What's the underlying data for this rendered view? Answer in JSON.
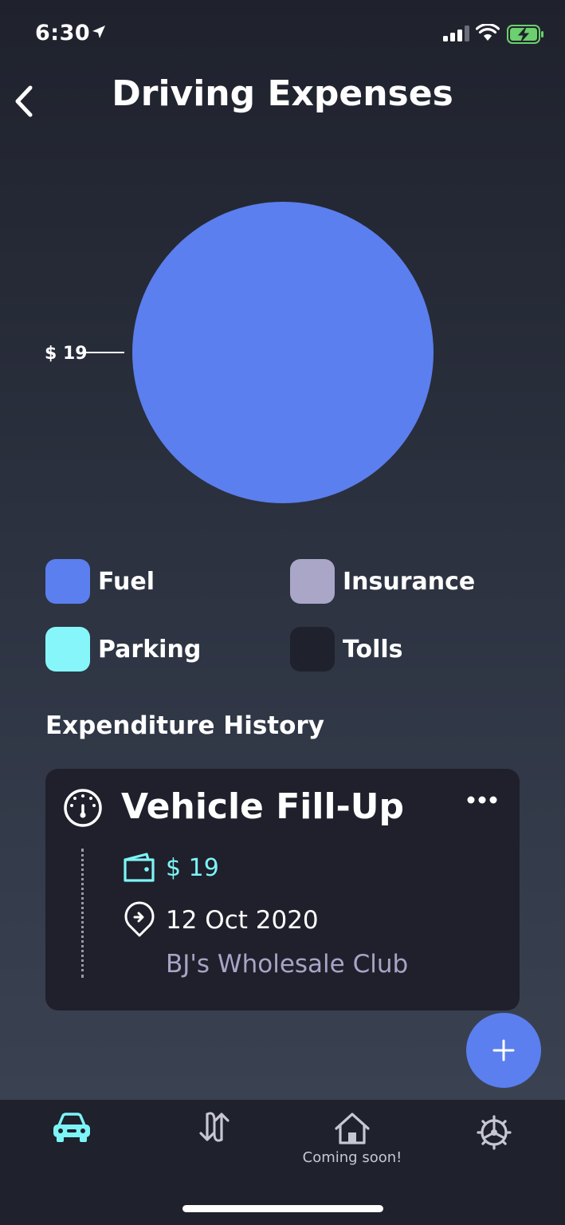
{
  "status_bar": {
    "time": "6:30"
  },
  "header": {
    "title": "Driving Expenses"
  },
  "chart_data": {
    "type": "pie",
    "slices": [
      {
        "label": "Fuel",
        "value": 19,
        "color": "#5b7fee"
      }
    ],
    "data_labels": [
      "$ 19"
    ],
    "legend": [
      {
        "label": "Fuel",
        "color": "#5b7fee"
      },
      {
        "label": "Insurance",
        "color": "#aaa6c8"
      },
      {
        "label": "Parking",
        "color": "#87f6fa"
      },
      {
        "label": "Tolls",
        "color": "#1f212c"
      }
    ],
    "legend_placement": "bottom"
  },
  "legend": {
    "fuel": "Fuel",
    "insurance": "Insurance",
    "parking": "Parking",
    "tolls": "Tolls"
  },
  "history": {
    "section_title": "Expenditure History",
    "items": [
      {
        "title": "Vehicle Fill-Up",
        "amount": "$ 19",
        "date": "12 Oct 2020",
        "place": "BJ's Wholesale Club"
      }
    ]
  },
  "tabbar": {
    "home_caption": "Coming soon!"
  },
  "colors": {
    "accent": "#5b7fee",
    "cyan": "#7df4f6",
    "card_bg": "#1f202b",
    "muted_text": "#a7a4c6"
  },
  "icons": [
    "location-arrow-icon",
    "signal-icon",
    "wifi-icon",
    "battery-charging-icon",
    "back-chevron-icon",
    "gauge-icon",
    "more-icon",
    "wallet-icon",
    "location-pin-icon",
    "plus-icon",
    "car-icon",
    "transfer-arrows-icon",
    "home-icon",
    "settings-gear-icon"
  ]
}
